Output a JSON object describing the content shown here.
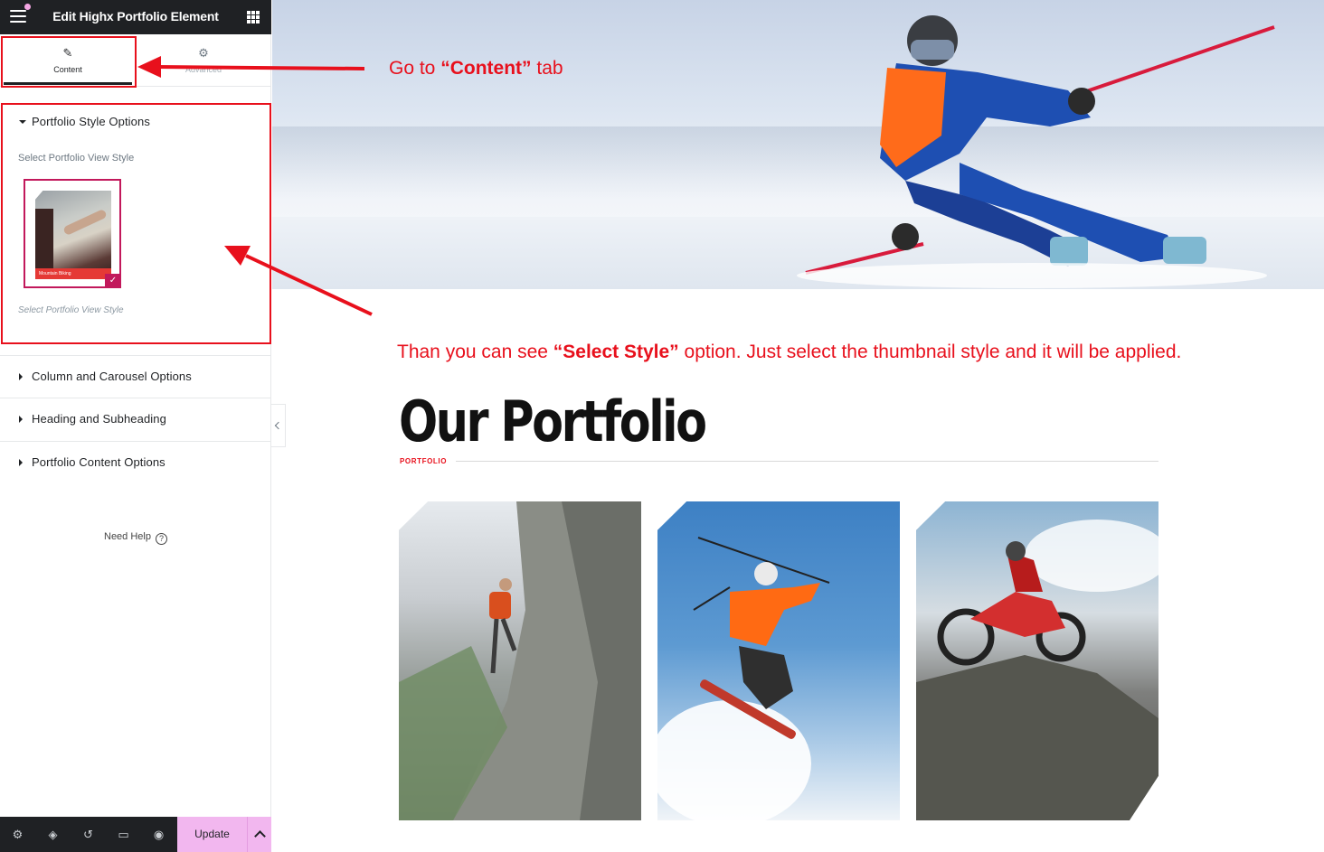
{
  "editor": {
    "title": "Edit Highx Portfolio Element",
    "tabs": [
      {
        "label": "Content",
        "icon": "pencil-icon",
        "active": true
      },
      {
        "label": "Advanced",
        "icon": "gear-icon",
        "active": false
      }
    ],
    "sections": [
      {
        "label": "Portfolio Style Options",
        "expanded": true
      },
      {
        "label": "Column and Carousel Options",
        "expanded": false
      },
      {
        "label": "Heading and Subheading",
        "expanded": false
      },
      {
        "label": "Portfolio Content Options",
        "expanded": false
      }
    ],
    "style_control": {
      "label": "Select Portfolio View Style",
      "thumbnail_caption": "Mountain Biking",
      "hint": "Select Portfolio View Style"
    },
    "need_help": "Need Help",
    "footer": {
      "icons": [
        "settings-icon",
        "layers-icon",
        "history-icon",
        "responsive-icon",
        "preview-icon"
      ],
      "update_label": "Update"
    },
    "accent_color": "#c2185b",
    "update_color": "#f2b7ef"
  },
  "annotations": {
    "tab_note": {
      "pre": "Go  to ",
      "bold": "“Content”",
      "post": " tab"
    },
    "style_note": {
      "pre": "Than you can see ",
      "bold": "“Select Style”",
      "post": " option. Just select the thumbnail style and it will be applied."
    },
    "color": "#e8101c"
  },
  "page": {
    "heading": "Our Portfolio",
    "subheading": "PORTFOLIO",
    "subheading_color": "#e8101c",
    "cards": [
      {
        "name": "rock-climbing-photo"
      },
      {
        "name": "snow-ski-jump-photo"
      },
      {
        "name": "motocross-photo"
      }
    ]
  }
}
